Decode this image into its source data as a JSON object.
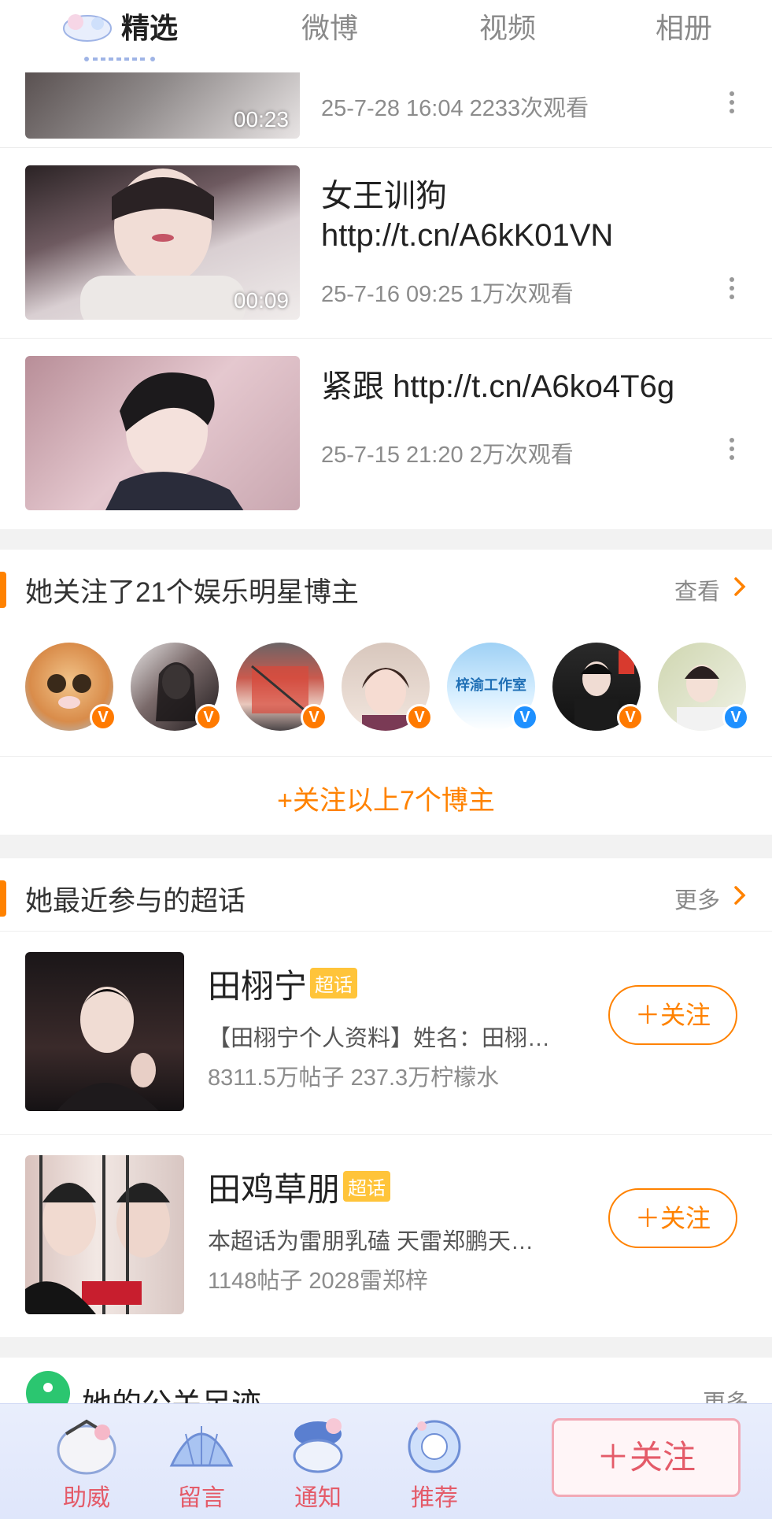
{
  "tabs": [
    {
      "label": "精选",
      "active": true
    },
    {
      "label": "微博",
      "active": false
    },
    {
      "label": "视频",
      "active": false
    },
    {
      "label": "相册",
      "active": false
    }
  ],
  "videos": [
    {
      "title": "",
      "duration": "00:23",
      "meta": "25-7-28 16:04 2233次观看"
    },
    {
      "title": "女王训狗 http://t.cn/A6kK01VN",
      "duration": "00:09",
      "meta": "25-7-16 09:25 1万次观看"
    },
    {
      "title": "紧跟 http://t.cn/A6ko4T6g",
      "duration": "",
      "meta": "25-7-15 21:20 2万次观看"
    }
  ],
  "stars_section": {
    "title": "她关注了21个娱乐明星博主",
    "more_label": "查看",
    "avatar_badges": [
      "V",
      "V",
      "V",
      "V",
      "V",
      "V",
      "V"
    ],
    "avatar_text": "梓渝工作室",
    "follow_all_label": "+关注以上7个博主"
  },
  "topics_section": {
    "title": "她最近参与的超话",
    "more_label": "更多",
    "topics": [
      {
        "name": "田栩宁",
        "tag": "超话",
        "desc": "【田栩宁个人资料】姓名：田栩…",
        "stats": "8311.5万帖子 237.3万柠檬水",
        "follow_label": "＋关注"
      },
      {
        "name": "田鸡草朋",
        "tag": "超话",
        "desc": "本超话为雷朋乳磕 天雷郑鹏天…",
        "stats": "1148帖子 2028雷郑梓",
        "follow_label": "＋关注"
      }
    ]
  },
  "next_section": {
    "title": "她的公关足迹",
    "more_label": "更多"
  },
  "bottom_bar": {
    "items": [
      {
        "label": "助威",
        "icon": "cheer-icon"
      },
      {
        "label": "留言",
        "icon": "shell-icon"
      },
      {
        "label": "通知",
        "icon": "bell-icon"
      },
      {
        "label": "推荐",
        "icon": "gift-icon"
      }
    ],
    "follow_label": "＋关注"
  },
  "colors": {
    "accent": "#ff8200",
    "badge_orange": "#ff7a00",
    "badge_blue": "#1e90ff",
    "pink": "#e45b69"
  }
}
